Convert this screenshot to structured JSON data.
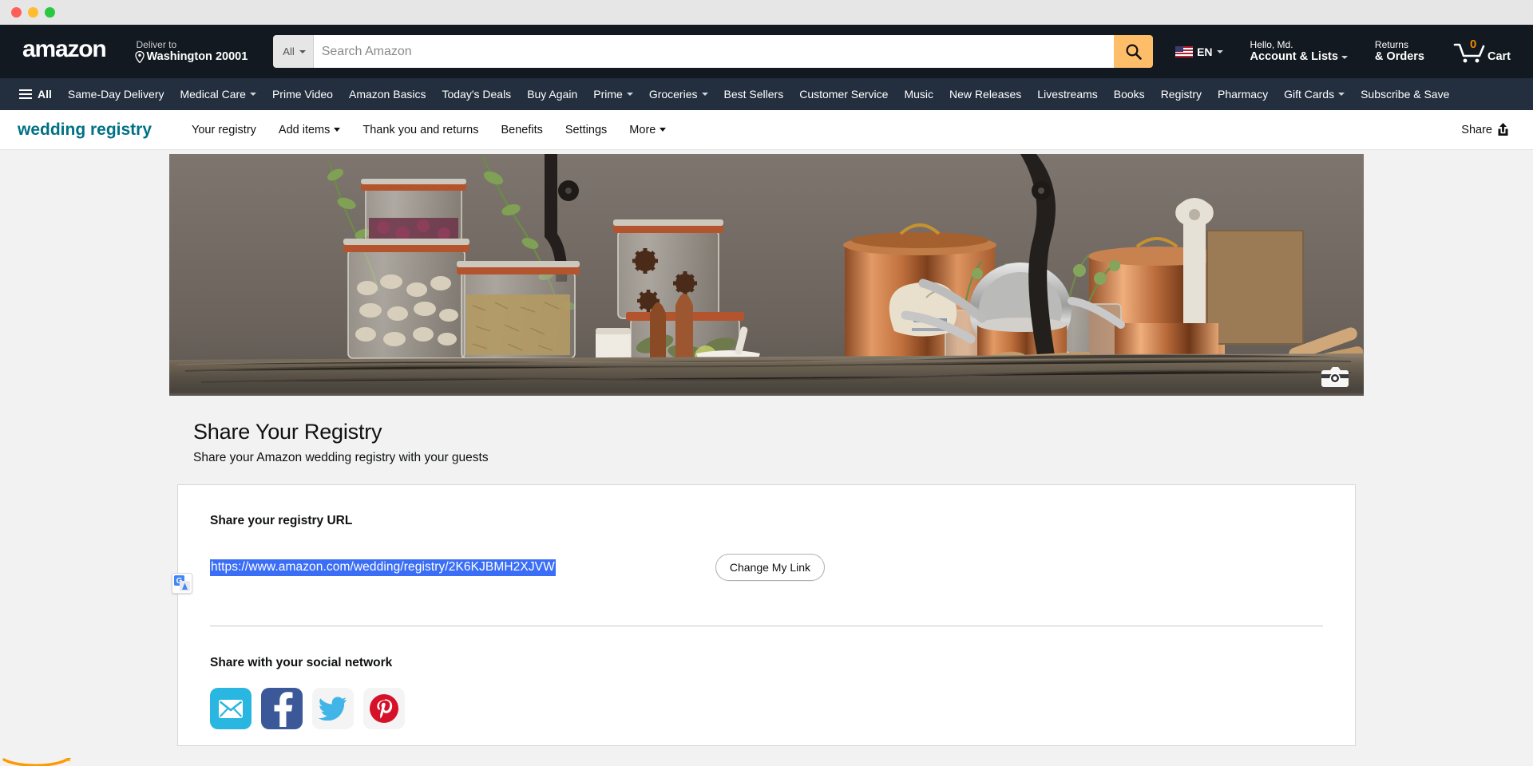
{
  "window": {
    "controls": [
      "close",
      "minimize",
      "maximize"
    ]
  },
  "header": {
    "logo": "amazon",
    "deliver_to_label": "Deliver to",
    "deliver_to_value": "Washington 20001",
    "search": {
      "category": "All",
      "placeholder": "Search Amazon",
      "value": ""
    },
    "language": {
      "code": "EN",
      "flag": "us-flag-icon"
    },
    "account": {
      "greeting": "Hello, Md.",
      "label": "Account & Lists"
    },
    "returns": {
      "line1": "Returns",
      "line2": "& Orders"
    },
    "cart": {
      "count": "0",
      "label": "Cart"
    }
  },
  "main_nav": {
    "all_label": "All",
    "items": [
      {
        "label": "Same-Day Delivery",
        "caret": false
      },
      {
        "label": "Medical Care",
        "caret": true
      },
      {
        "label": "Prime Video",
        "caret": false
      },
      {
        "label": "Amazon Basics",
        "caret": false
      },
      {
        "label": "Today's Deals",
        "caret": false
      },
      {
        "label": "Buy Again",
        "caret": false
      },
      {
        "label": "Prime",
        "caret": true
      },
      {
        "label": "Groceries",
        "caret": true
      },
      {
        "label": "Best Sellers",
        "caret": false
      },
      {
        "label": "Customer Service",
        "caret": false
      },
      {
        "label": "Music",
        "caret": false
      },
      {
        "label": "New Releases",
        "caret": false
      },
      {
        "label": "Livestreams",
        "caret": false
      },
      {
        "label": "Books",
        "caret": false
      },
      {
        "label": "Registry",
        "caret": false
      },
      {
        "label": "Pharmacy",
        "caret": false
      },
      {
        "label": "Gift Cards",
        "caret": true
      },
      {
        "label": "Subscribe & Save",
        "caret": false
      }
    ]
  },
  "registry_nav": {
    "brand": "wedding registry",
    "items": [
      {
        "label": "Your registry",
        "caret": false
      },
      {
        "label": "Add items",
        "caret": true
      },
      {
        "label": "Thank you and returns",
        "caret": false
      },
      {
        "label": "Benefits",
        "caret": false
      },
      {
        "label": "Settings",
        "caret": false
      },
      {
        "label": "More",
        "caret": true
      }
    ],
    "share_label": "Share"
  },
  "hero": {
    "alt": "Kitchen shelf with glass storage jars, copper pots and wooden cutting board",
    "camera_icon": "camera-icon"
  },
  "main": {
    "title": "Share Your Registry",
    "subtitle": "Share your Amazon wedding registry with your guests",
    "url_section": {
      "heading": "Share your registry URL",
      "url": "https://www.amazon.com/wedding/registry/2K6KJBMH2XJVW",
      "url_selected": true,
      "change_button": "Change My Link",
      "translate_icon": "google-translate-icon"
    },
    "social_section": {
      "heading": "Share with your social network",
      "items": [
        {
          "name": "email",
          "icon": "email-icon",
          "color": "#29b6e0"
        },
        {
          "name": "facebook",
          "icon": "facebook-icon",
          "color": "#3b5998"
        },
        {
          "name": "twitter",
          "icon": "twitter-icon",
          "color": "#41b4e8"
        },
        {
          "name": "pinterest",
          "icon": "pinterest-icon",
          "color": "#d6112a"
        }
      ]
    }
  },
  "colors": {
    "amazon_dark": "#131921",
    "amazon_nav": "#232f3e",
    "accent_orange": "#febd69",
    "teal_link": "#007185",
    "selection_blue": "#3b6ef6",
    "page_bg": "#f2f2f2"
  }
}
